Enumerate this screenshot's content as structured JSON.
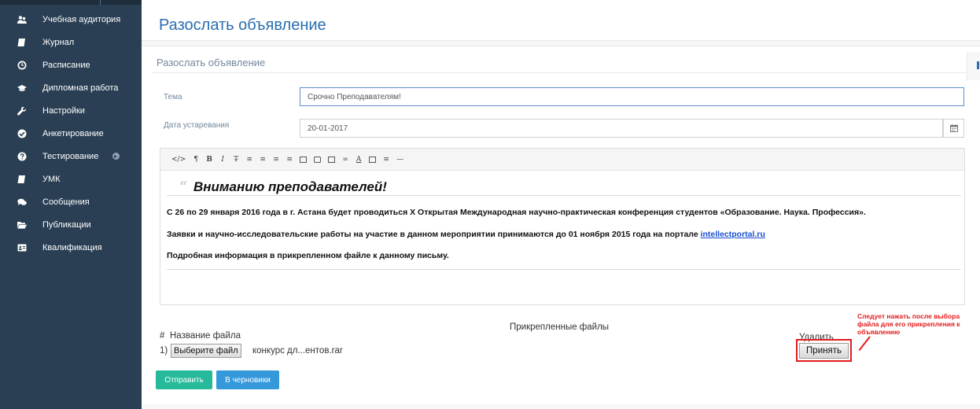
{
  "page": {
    "title": "Разослать объявление"
  },
  "sidebar": {
    "items": [
      {
        "label": "Учебная аудитория",
        "icon": "users-icon"
      },
      {
        "label": "Журнал",
        "icon": "book-icon"
      },
      {
        "label": "Расписание",
        "icon": "clock-icon"
      },
      {
        "label": "Дипломная работа",
        "icon": "graduation-cap-icon"
      },
      {
        "label": "Настройки",
        "icon": "wrench-icon"
      },
      {
        "label": "Анкетирование",
        "icon": "check-circle-icon"
      },
      {
        "label": "Тестирование",
        "icon": "question-circle-icon",
        "has_submenu": true
      },
      {
        "label": "УМК",
        "icon": "book-icon"
      },
      {
        "label": "Сообщения",
        "icon": "comments-icon"
      },
      {
        "label": "Публикации",
        "icon": "folder-open-icon"
      },
      {
        "label": "Квалификация",
        "icon": "id-card-icon"
      }
    ]
  },
  "panel": {
    "title": "Разослать объявление"
  },
  "form": {
    "subject_label": "Тема",
    "subject_value": "Срочно Преподавателям!",
    "expiry_label": "Дата устаревания",
    "expiry_value": "20-01-2017"
  },
  "editor": {
    "toolbar": [
      "</>",
      "¶",
      "B",
      "I",
      "T̶",
      "list-ul",
      "list-ol",
      "outdent",
      "indent",
      "image",
      "video",
      "table",
      "link",
      "A",
      "highlight",
      "align",
      "hr"
    ],
    "quote": "Вниманию преподавателей!",
    "paragraphs": [
      "С 26 по 29 января 2016 года в г. Астана будет проводиться X Открытая Международная научно-практическая конференция студентов «Образование. Наука. Профессия».",
      "Заявки и научно-исследовательские работы на участие в данном мероприятии принимаются до 01 ноября 2015 года на портале ",
      "Подробная информация в прикрепленном файле к данному письму."
    ],
    "link_text": "intellectportal.ru"
  },
  "attachments": {
    "title": "Прикрепленные файлы",
    "col_hash": "#",
    "col_name": "Название файла",
    "col_delete": "Удалить",
    "rows": [
      {
        "num": "1)",
        "choose_label": "Выберите файл",
        "file_name": "конкурс дл...ентов.rar",
        "accept_label": "Принять"
      }
    ]
  },
  "annotation": {
    "text": "Следует нажать после выбора файла для его прикрепления к объявлению",
    "color": "#e21b1b"
  },
  "actions": {
    "send_label": "Отправить",
    "draft_label": "В черновики"
  },
  "colors": {
    "sidebar": "#2a3f54",
    "title": "#2a6db0",
    "send": "#26b99a",
    "draft": "#3498db"
  }
}
